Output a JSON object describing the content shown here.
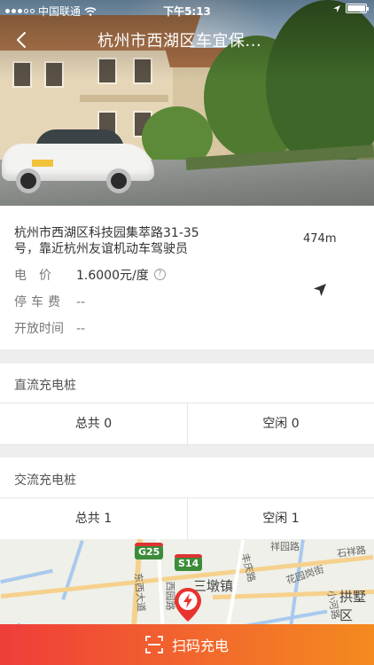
{
  "status_bar": {
    "carrier": "中国联通",
    "time": "下午5:13"
  },
  "header": {
    "title": "杭州市西湖区车宜保...",
    "back_icon": "chevron-left-icon"
  },
  "station": {
    "address": "杭州市西湖区科技园集萃路31-35号，靠近杭州友谊机动车驾驶员",
    "distance": "474m",
    "price_label": "电　价",
    "price_value": "1.6000元/度",
    "parking_label": "停车费",
    "parking_value": "--",
    "hours_label": "开放时间",
    "hours_value": "--"
  },
  "dc_section": {
    "title": "直流充电桩",
    "total": "总共 0",
    "idle": "空闲 0"
  },
  "ac_section": {
    "title": "交流充电桩",
    "total": "总共 1",
    "idle": "空闲 1"
  },
  "map": {
    "labels": [
      "三墩镇",
      "拱墅区",
      "花园岗街",
      "石祥路",
      "祥园路",
      "丰庆路",
      "西园路",
      "东西大道",
      "小河路"
    ],
    "highway_badges": [
      "G25",
      "S14"
    ]
  },
  "bottom_button": {
    "label": "扫码充电"
  },
  "colors": {
    "accent_start": "#ef3d3a",
    "accent_end": "#f58a1f",
    "pin": "#e8332f"
  }
}
